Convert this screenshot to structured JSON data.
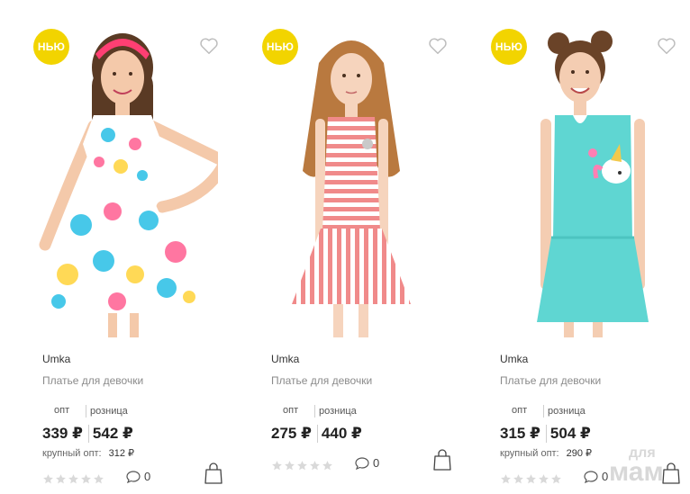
{
  "products": [
    {
      "badge": "НЬЮ",
      "brand": "Umka",
      "name": "Платье для девочки",
      "label_opt": "опт",
      "label_retail": "розница",
      "price_opt": "339 ₽",
      "price_retail": "542 ₽",
      "wholesale_label": "крупный опт:",
      "wholesale_price": "312 ₽",
      "rating": 0,
      "comments": "0",
      "dress_color": "#ffffff"
    },
    {
      "badge": "НЬЮ",
      "brand": "Umka",
      "name": "Платье для девочки",
      "label_opt": "опт",
      "label_retail": "розница",
      "price_opt": "275 ₽",
      "price_retail": "440 ₽",
      "rating": 0,
      "comments": "0",
      "dress_color": "#f08a8a"
    },
    {
      "badge": "НЬЮ",
      "brand": "Umka",
      "name": "Платье для девочки",
      "label_opt": "опт",
      "label_retail": "розница",
      "price_opt": "315 ₽",
      "price_retail": "504 ₽",
      "wholesale_label": "крупный опт:",
      "wholesale_price": "290 ₽",
      "rating": 0,
      "comments": "0",
      "dress_color": "#5fd6d2"
    }
  ],
  "icons": {
    "favorite": "heart-outline-icon",
    "comments": "speech-bubble-icon",
    "cart": "shopping-bag-icon",
    "rating": "star-icon"
  },
  "colors": {
    "badge_bg": "#f2d400",
    "star_empty": "#d9d9d9",
    "muted_text": "#8a8a8a"
  },
  "watermark": {
    "line1": "для",
    "line2": "мам"
  }
}
